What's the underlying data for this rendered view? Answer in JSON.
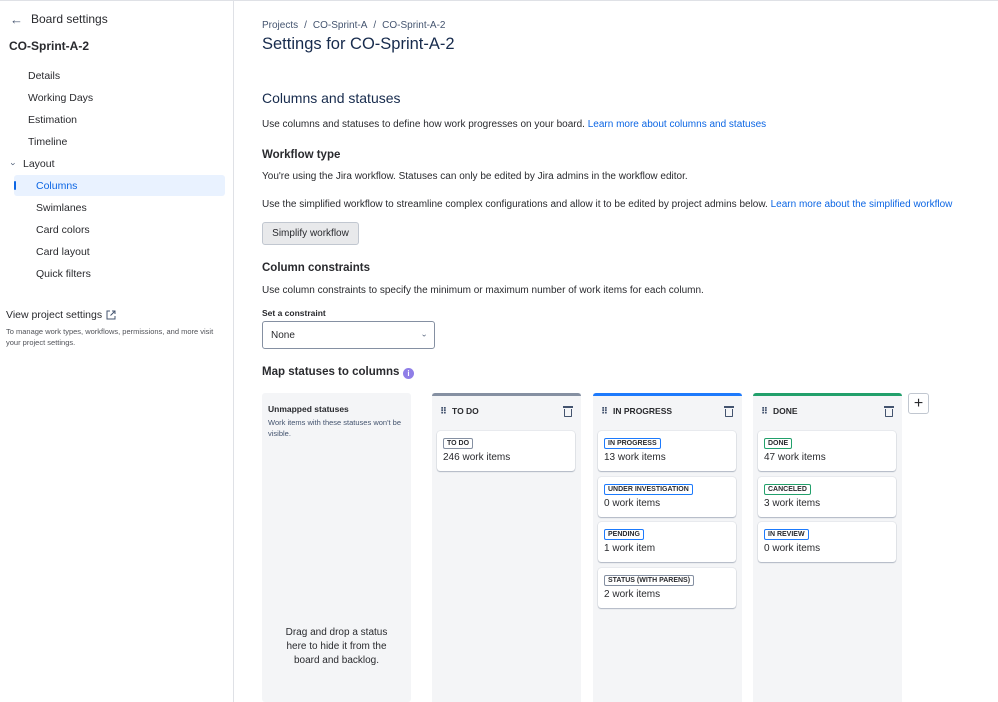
{
  "sidebar": {
    "header_title": "Board settings",
    "board_name": "CO-Sprint-A-2",
    "items": [
      {
        "label": "Details"
      },
      {
        "label": "Working Days"
      },
      {
        "label": "Estimation"
      },
      {
        "label": "Timeline"
      },
      {
        "label": "Layout"
      },
      {
        "label": "Columns"
      },
      {
        "label": "Swimlanes"
      },
      {
        "label": "Card colors"
      },
      {
        "label": "Card layout"
      },
      {
        "label": "Quick filters"
      }
    ],
    "view_project_settings": "View project settings",
    "view_project_settings_sub": "To manage work types, workflows, permissions, and more visit your project settings."
  },
  "breadcrumb": [
    "Projects",
    "CO-Sprint-A",
    "CO-Sprint-A-2"
  ],
  "page_title": "Settings for CO-Sprint-A-2",
  "columns_statuses": {
    "heading": "Columns and statuses",
    "desc": "Use columns and statuses to define how work progresses on your board.",
    "desc_link": "Learn more about columns and statuses"
  },
  "workflow": {
    "heading": "Workflow type",
    "desc1": "You're using the Jira workflow. Statuses can only be edited by Jira admins in the workflow editor.",
    "desc2": "Use the simplified workflow to streamline complex configurations and allow it to be edited by project admins below.",
    "desc2_link": "Learn more about the simplified workflow",
    "button": "Simplify workflow"
  },
  "constraints": {
    "heading": "Column constraints",
    "desc": "Use column constraints to specify the minimum or maximum number of work items for each column.",
    "label": "Set a constraint",
    "value": "None"
  },
  "map": {
    "heading": "Map statuses to columns",
    "unmapped_title": "Unmapped statuses",
    "unmapped_sub": "Work items with these statuses won't be visible.",
    "unmapped_drop": "Drag and drop a status here to hide it from the board and backlog.",
    "columns": [
      {
        "name": "TO DO",
        "color": "#8590a2",
        "statuses": [
          {
            "label": "TO DO",
            "count": "246",
            "unit": "work items",
            "lozenge_color": "#8590a2"
          }
        ]
      },
      {
        "name": "IN PROGRESS",
        "color": "#1d7afc",
        "statuses": [
          {
            "label": "IN PROGRESS",
            "count": "13",
            "unit": "work items",
            "lozenge_color": "#1d7afc"
          },
          {
            "label": "UNDER INVESTIGATION",
            "count": "0",
            "unit": "work items",
            "lozenge_color": "#1d7afc"
          },
          {
            "label": "PENDING",
            "count": "1",
            "unit": "work item",
            "lozenge_color": "#1d7afc"
          },
          {
            "label": "STATUS (WITH PARENS)",
            "count": "2",
            "unit": "work items",
            "lozenge_color": "#8590a2"
          }
        ]
      },
      {
        "name": "DONE",
        "color": "#22a06b",
        "statuses": [
          {
            "label": "DONE",
            "count": "47",
            "unit": "work items",
            "lozenge_color": "#22a06b"
          },
          {
            "label": "CANCELED",
            "count": "3",
            "unit": "work items",
            "lozenge_color": "#22a06b"
          },
          {
            "label": "IN REVIEW",
            "count": "0",
            "unit": "work items",
            "lozenge_color": "#1d7afc"
          }
        ]
      }
    ]
  }
}
